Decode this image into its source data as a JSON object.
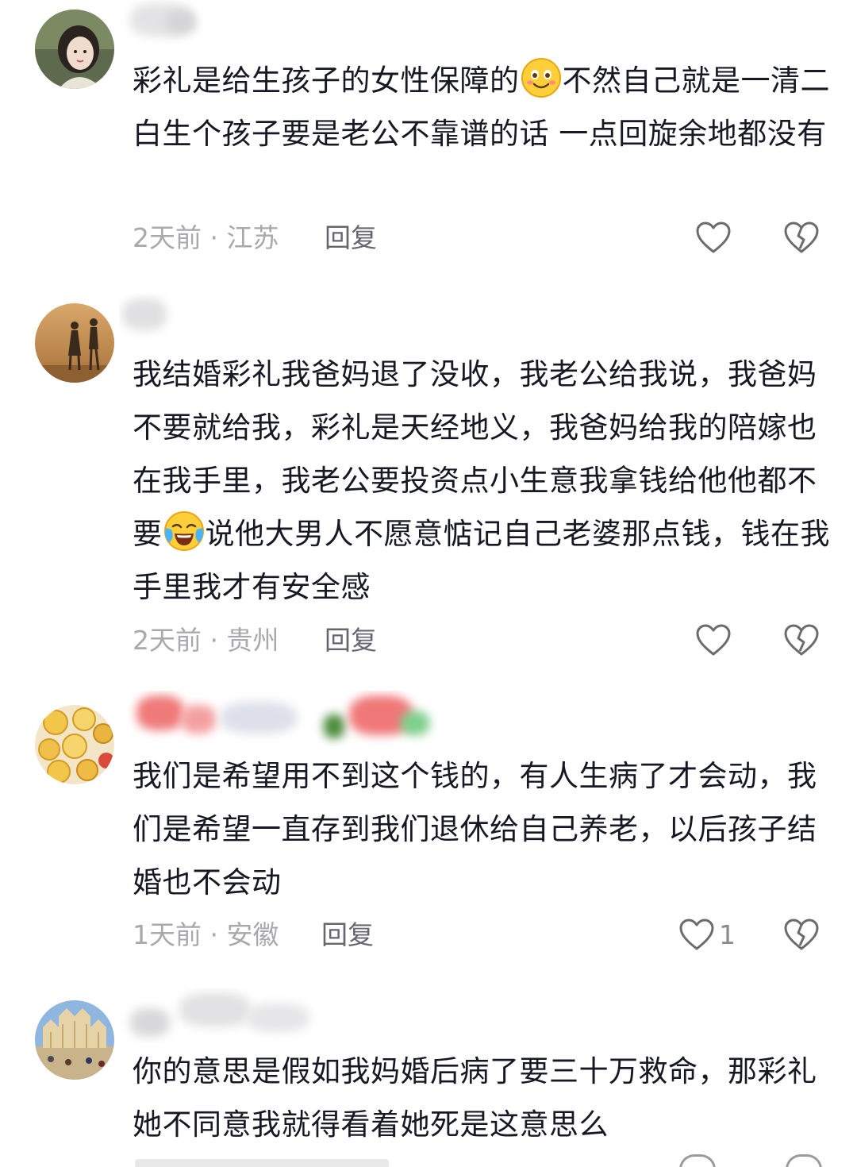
{
  "comments": [
    {
      "text_before": "彩礼是给生孩子的女性保障的",
      "emoji": "smiling-face",
      "text_after": "不然自己就是一清二白生个孩子要是老公不靠谱的话 一点回旋余地都没有",
      "time_location": "2天前 · 江苏",
      "reply_label": "回复",
      "like_count": ""
    },
    {
      "text_before": "我结婚彩礼我爸妈退了没收，我老公给我说，我爸妈不要就给我，彩礼是天经地义，我爸妈给我的陪嫁也在我手里，我老公要投资点小生意我拿钱给他他都不要",
      "emoji": "crying-laughing-face",
      "text_after": "说他大男人不愿意惦记自己老婆那点钱，钱在我手里我才有安全感",
      "time_location": "2天前 · 贵州",
      "reply_label": "回复",
      "like_count": ""
    },
    {
      "text_before": "我们是希望用不到这个钱的，有人生病了才会动，我们是希望一直存到我们退休给自己养老，以后孩子结婚也不会动",
      "emoji": "",
      "text_after": "",
      "time_location": "1天前 · 安徽",
      "reply_label": "回复",
      "like_count": "1"
    },
    {
      "text_before": "你的意思是假如我妈婚后病了要三十万救命，那彩礼她不同意我就得看着她死是这意思么",
      "emoji": "",
      "text_after": "",
      "time_location": "",
      "reply_label": "",
      "like_count": ""
    }
  ],
  "colors": {
    "text": "#161823",
    "meta": "#a8a8ad",
    "reply": "#666670",
    "icon": "#6b6b70"
  }
}
